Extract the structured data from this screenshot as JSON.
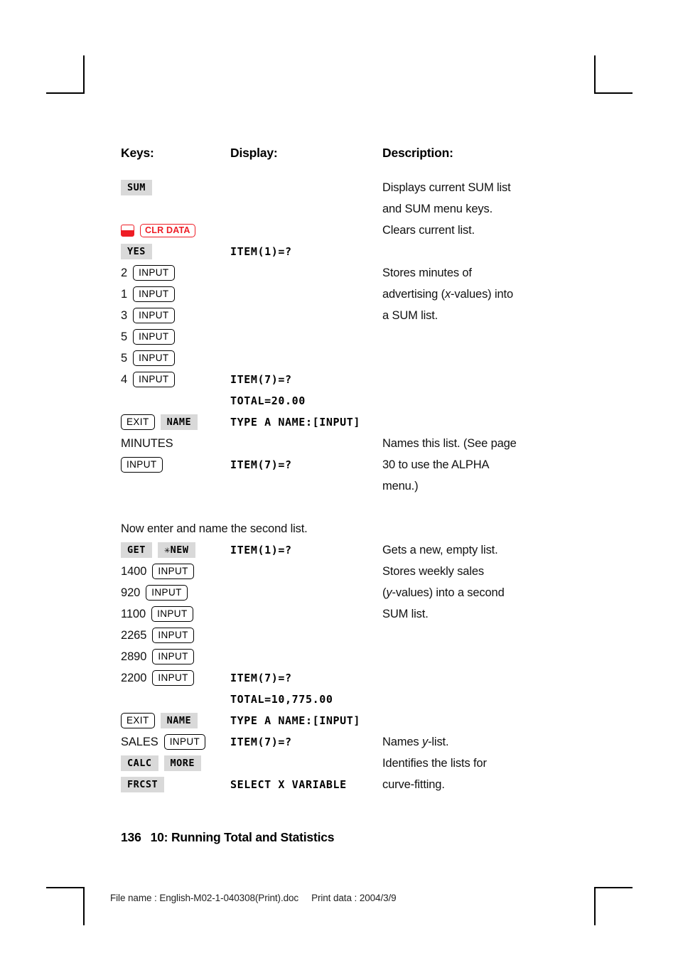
{
  "columns": {
    "keys": "Keys:",
    "display": "Display:",
    "description": "Description:"
  },
  "keys": {
    "sum": "SUM",
    "clr_data": "CLR DATA",
    "yes": "YES",
    "input": "INPUT",
    "exit": "EXIT",
    "name": "NAME",
    "get": "GET",
    "new": "✳NEW",
    "calc": "CALC",
    "more": "MORE",
    "frcst": "FRCST"
  },
  "rows": [
    {
      "key_type": "softkey",
      "keys": [
        "SUM"
      ],
      "display": "",
      "desc": "Displays current SUM list"
    },
    {
      "key_type": "none",
      "keys": [],
      "display": "",
      "desc": "and SUM menu keys."
    },
    {
      "key_type": "redkey",
      "keys": [
        "CLR DATA"
      ],
      "display": "",
      "desc": "Clears current list."
    },
    {
      "key_type": "softkey",
      "keys": [
        "YES"
      ],
      "display": "ITEM(1)=?",
      "desc": ""
    },
    {
      "key_type": "numkey",
      "number": "2",
      "keys": [
        "INPUT"
      ],
      "display": "",
      "desc": "Stores minutes of"
    },
    {
      "key_type": "numkey",
      "number": "1",
      "keys": [
        "INPUT"
      ],
      "display": "",
      "desc": "advertising (x-values) into"
    },
    {
      "key_type": "numkey",
      "number": "3",
      "keys": [
        "INPUT"
      ],
      "display": "",
      "desc": "a SUM list."
    },
    {
      "key_type": "numkey",
      "number": "5",
      "keys": [
        "INPUT"
      ],
      "display": "",
      "desc": ""
    },
    {
      "key_type": "numkey",
      "number": "5",
      "keys": [
        "INPUT"
      ],
      "display": "",
      "desc": ""
    },
    {
      "key_type": "numkey",
      "number": "4",
      "keys": [
        "INPUT"
      ],
      "display": "ITEM(7)=?",
      "desc": ""
    },
    {
      "key_type": "none",
      "keys": [],
      "display": "TOTAL=20.00",
      "desc": ""
    },
    {
      "key_type": "mixed",
      "keys": [
        "EXIT",
        "NAME"
      ],
      "display": "TYPE A NAME:[INPUT]",
      "desc": ""
    },
    {
      "key_type": "text",
      "text": "MINUTES",
      "display": "",
      "desc": "Names this list. (See page"
    },
    {
      "key_type": "hardkey",
      "keys": [
        "INPUT"
      ],
      "display": "ITEM(7)=?",
      "desc": "30 to use the ALPHA"
    },
    {
      "key_type": "none",
      "keys": [],
      "display": "",
      "desc": "menu.)"
    }
  ],
  "narrative": "Now enter and name the second list.",
  "rows2": [
    {
      "key_type": "softkey",
      "keys": [
        "GET",
        "✳NEW"
      ],
      "display": "ITEM(1)=?",
      "desc": "Gets a new, empty list."
    },
    {
      "key_type": "numkey",
      "number": "1400",
      "keys": [
        "INPUT"
      ],
      "display": "",
      "desc": "Stores weekly sales"
    },
    {
      "key_type": "numkey",
      "number": "920",
      "keys": [
        "INPUT"
      ],
      "display": "",
      "desc": "(y-values) into a second"
    },
    {
      "key_type": "numkey",
      "number": "1100",
      "keys": [
        "INPUT"
      ],
      "display": "",
      "desc": "SUM list."
    },
    {
      "key_type": "numkey",
      "number": "2265",
      "keys": [
        "INPUT"
      ],
      "display": "",
      "desc": ""
    },
    {
      "key_type": "numkey",
      "number": "2890",
      "keys": [
        "INPUT"
      ],
      "display": "",
      "desc": ""
    },
    {
      "key_type": "numkey",
      "number": "2200",
      "keys": [
        "INPUT"
      ],
      "display": "ITEM(7)=?",
      "desc": ""
    },
    {
      "key_type": "none",
      "keys": [],
      "display": "TOTAL=10,775.00",
      "desc": ""
    },
    {
      "key_type": "mixed",
      "keys": [
        "EXIT",
        "NAME"
      ],
      "display": "TYPE A NAME:[INPUT]",
      "desc": ""
    },
    {
      "key_type": "textkey",
      "text": "SALES",
      "keys": [
        "INPUT"
      ],
      "display": "ITEM(7)=?",
      "desc": "Names y-list."
    },
    {
      "key_type": "softkey",
      "keys": [
        "CALC",
        "MORE"
      ],
      "display": "",
      "desc": "Identifies the lists for"
    },
    {
      "key_type": "softkey",
      "keys": [
        "FRCST"
      ],
      "display": "SELECT X VARIABLE",
      "desc": "curve-fitting."
    }
  ],
  "display_lines": {
    "item1": "ITEM(1)=?",
    "item7": "ITEM(7)=?",
    "total_x": "TOTAL=20.00",
    "total_y": "TOTAL=10,775.00",
    "type_a_name": "TYPE A NAME:[INPUT]",
    "select_x": "SELECT X VARIABLE"
  },
  "typed_text": {
    "minutes": "MINUTES",
    "sales": "SALES"
  },
  "descriptions": {
    "d1": "Displays current SUM list",
    "d2": "and SUM menu keys.",
    "d3": "Clears current list.",
    "d4": "Stores minutes of",
    "d5a": "advertising (",
    "d5b": "x",
    "d5c": "-values) into",
    "d6": "a SUM list.",
    "d7": "Names this list. (See page",
    "d8": "30 to use the ALPHA",
    "d9": "menu.)",
    "d10": "Gets a new, empty list.",
    "d11": "Stores weekly sales",
    "d12a": "(",
    "d12b": "y",
    "d12c": "-values) into a second",
    "d13": "SUM list.",
    "d14a": "Names ",
    "d14b": "y",
    "d14c": "-list.",
    "d15": "Identifies the lists for",
    "d16": "curve-fitting."
  },
  "footer": {
    "page_number": "136",
    "chapter": "10: Running Total and Statistics",
    "file_name_label": "File name : English-M02-1-040308(Print).doc",
    "print_data_label": "Print data : 2004/3/9"
  },
  "colors": {
    "red_key": "#ee1c25",
    "softkey_bg": "#d9d9d9",
    "text": "#000000"
  }
}
